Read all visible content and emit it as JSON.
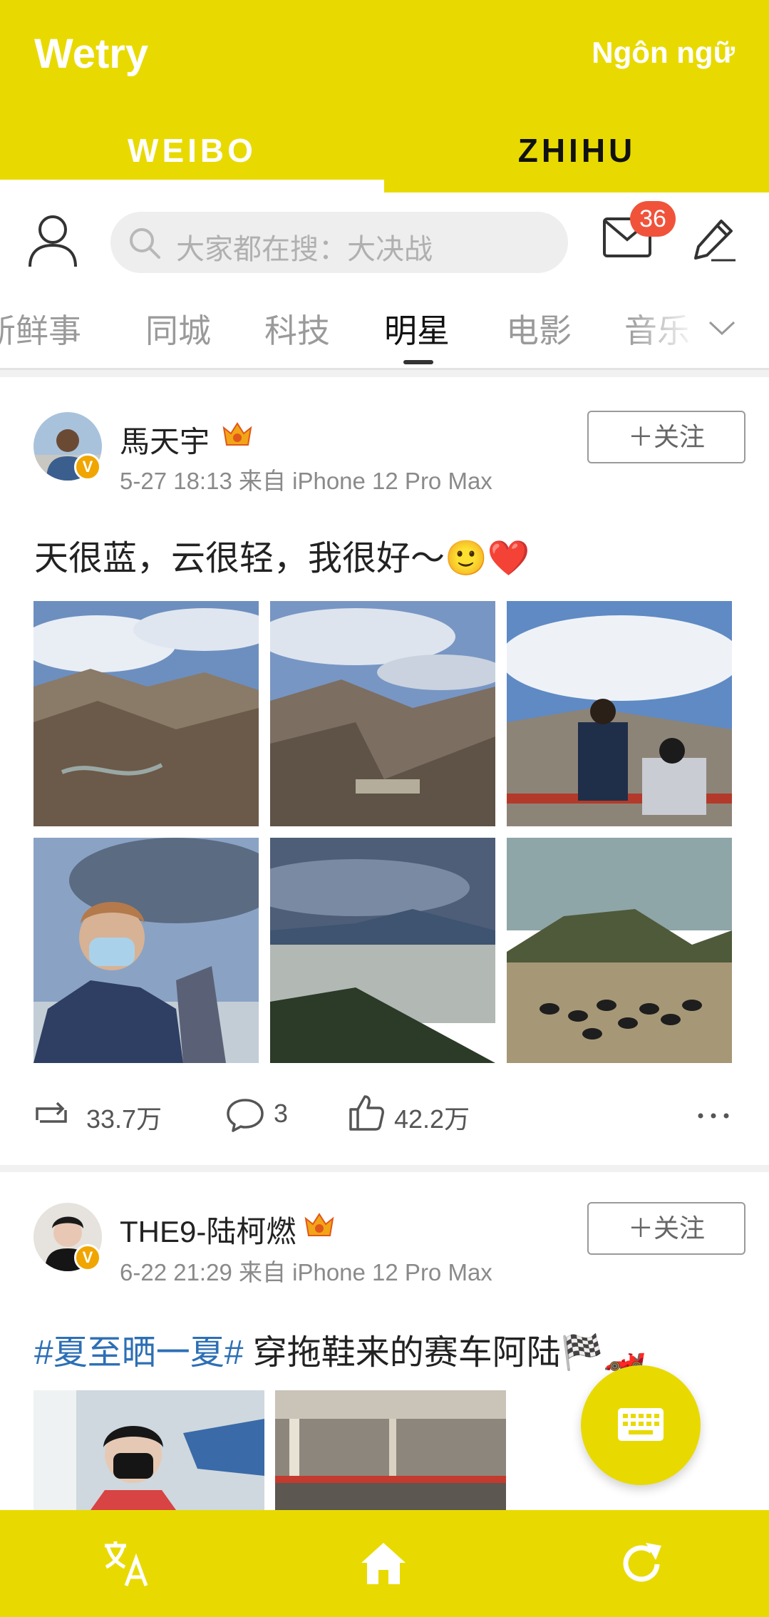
{
  "app": {
    "title": "Wetry",
    "language_label": "Ngôn ngữ",
    "accent": "#e8da00"
  },
  "tabs": [
    {
      "label": "WEIBO",
      "active": true
    },
    {
      "label": "ZHIHU",
      "active": false
    }
  ],
  "search": {
    "placeholder": "大家都在搜：大决战"
  },
  "messages": {
    "badge_count": "36"
  },
  "categories": [
    {
      "label": "新鲜事"
    },
    {
      "label": "同城"
    },
    {
      "label": "科技"
    },
    {
      "label": "明星",
      "active": true
    },
    {
      "label": "电影"
    },
    {
      "label": "音乐"
    }
  ],
  "posts": [
    {
      "username": "馬天宇",
      "time": "5-27 18:13 来自 iPhone 12 Pro Max",
      "follow_label": "＋关注",
      "text": "天很蓝，云很轻，我很好～🙂❤️",
      "reposts": "33.7万",
      "comments": "3",
      "likes": "42.2万"
    },
    {
      "username": "THE9-陆柯燃",
      "time": "6-22 21:29 来自 iPhone 12 Pro Max",
      "follow_label": "＋关注",
      "hashtag": "#夏至晒一夏#",
      "text": " 穿拖鞋来的赛车阿陆🏁🏎️"
    }
  ],
  "bottom_nav": [
    {
      "icon": "translate-icon"
    },
    {
      "icon": "home-icon"
    },
    {
      "icon": "refresh-icon"
    }
  ]
}
